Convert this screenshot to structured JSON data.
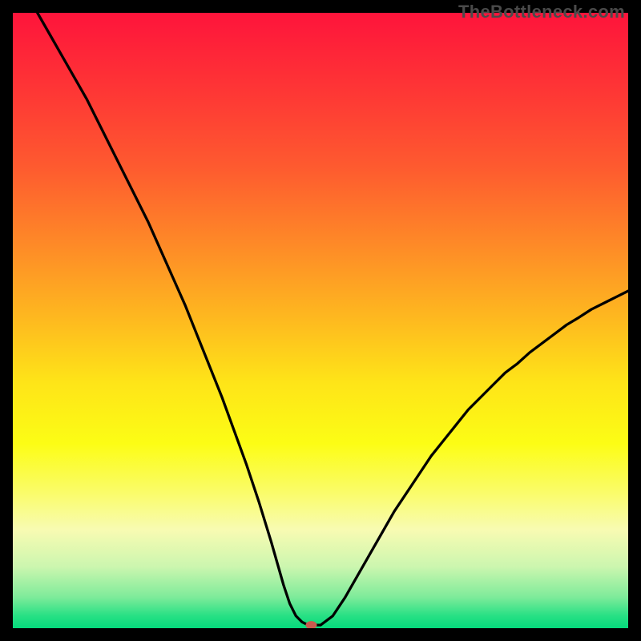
{
  "watermark": "TheBottleneck.com",
  "chart_data": {
    "type": "line",
    "title": "",
    "xlabel": "",
    "ylabel": "",
    "xlim": [
      0,
      100
    ],
    "ylim": [
      0,
      100
    ],
    "background_gradient": {
      "stops": [
        {
          "pos": 0.0,
          "color": "#fe143b"
        },
        {
          "pos": 0.13,
          "color": "#fe3735"
        },
        {
          "pos": 0.25,
          "color": "#fe5a2f"
        },
        {
          "pos": 0.38,
          "color": "#fe8b27"
        },
        {
          "pos": 0.5,
          "color": "#feba1f"
        },
        {
          "pos": 0.6,
          "color": "#fee418"
        },
        {
          "pos": 0.7,
          "color": "#fcfd15"
        },
        {
          "pos": 0.78,
          "color": "#fafc6a"
        },
        {
          "pos": 0.84,
          "color": "#f8fbb2"
        },
        {
          "pos": 0.9,
          "color": "#ccf6af"
        },
        {
          "pos": 0.95,
          "color": "#7deb9a"
        },
        {
          "pos": 0.98,
          "color": "#27e084"
        },
        {
          "pos": 1.0,
          "color": "#05da7c"
        }
      ]
    },
    "series": [
      {
        "name": "bottleneck-curve",
        "color": "#000000",
        "x": [
          4,
          6,
          8,
          10,
          12,
          14,
          16,
          18,
          20,
          22,
          24,
          26,
          28,
          30,
          32,
          34,
          36,
          38,
          40,
          42,
          43,
          44,
          45,
          46,
          47,
          48,
          49,
          50,
          52,
          54,
          56,
          58,
          60,
          62,
          64,
          66,
          68,
          70,
          72,
          74,
          76,
          78,
          80,
          82,
          84,
          86,
          88,
          90,
          92,
          94,
          96,
          98,
          100
        ],
        "y": [
          100,
          96.5,
          93,
          89.5,
          86,
          82,
          78,
          74,
          70,
          66,
          61.5,
          57,
          52.5,
          47.5,
          42.5,
          37.5,
          32,
          26.5,
          20.5,
          14,
          10.5,
          7,
          4,
          2,
          1,
          0.5,
          0.5,
          0.5,
          2,
          5,
          8.5,
          12,
          15.5,
          19,
          22,
          25,
          28,
          30.5,
          33,
          35.5,
          37.5,
          39.5,
          41.5,
          43,
          44.8,
          46.3,
          47.8,
          49.3,
          50.5,
          51.8,
          52.8,
          53.8,
          54.8
        ]
      }
    ],
    "marker": {
      "name": "optimal-point",
      "x": 48.5,
      "y": 0.5,
      "color": "#c85a4e",
      "rx": 7,
      "ry": 5
    }
  }
}
